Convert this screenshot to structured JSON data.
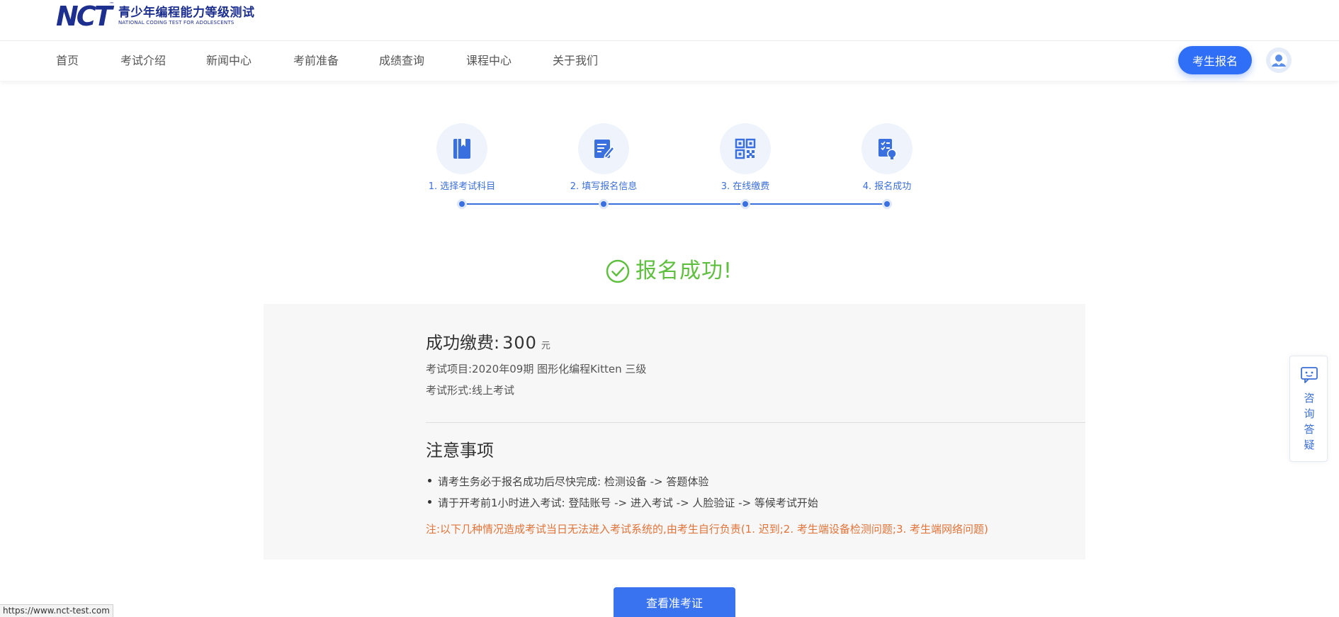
{
  "logo": {
    "mark": "NCT",
    "tm": "™",
    "title_cn": "青少年编程能力等级测试",
    "title_en": "NATIONAL CODING TEST FOR ADOLESCENTS"
  },
  "nav": {
    "items": [
      "首页",
      "考试介绍",
      "新闻中心",
      "考前准备",
      "成绩查询",
      "课程中心",
      "关于我们"
    ],
    "signup_label": "考生报名"
  },
  "steps": [
    {
      "label": "1. 选择考试科目",
      "icon": "book-icon"
    },
    {
      "label": "2. 填写报名信息",
      "icon": "edit-form-icon"
    },
    {
      "label": "3. 在线缴费",
      "icon": "qr-code-icon"
    },
    {
      "label": "4. 报名成功",
      "icon": "checklist-icon"
    }
  ],
  "success": {
    "title": "报名成功!",
    "icon": "check-circle-icon"
  },
  "payment": {
    "label": "成功缴费:",
    "amount": "300",
    "unit": "元",
    "exam_item": "考试项目:2020年09期 图形化编程Kitten 三级",
    "exam_format": "考试形式:线上考试"
  },
  "notice": {
    "title": "注意事项",
    "items": [
      "请考生务必于报名成功后尽快完成:  检测设备 -> 答题体验",
      "请于开考前1小时进入考试:  登陆账号 -> 进入考试 -> 人脸验证 -> 等候考试开始"
    ],
    "warning": "注:以下几种情况造成考试当日无法进入考试系统的,由考生自行负责(1. 迟到;2. 考生端设备检测问题;3. 考生端网络问题)"
  },
  "ticket_button": "查看准考证",
  "consult": {
    "label": "咨询答疑",
    "chars": [
      "咨",
      "询",
      "答",
      "疑"
    ],
    "icon": "chat-icon"
  },
  "status_url": "https://www.nct-test.com",
  "colors": {
    "primary": "#2f6ef7",
    "step_blue": "#3a6fe0",
    "success_green": "#5fbf3f",
    "warning_orange": "#e0743a",
    "logo_navy": "#1d2f8f"
  }
}
